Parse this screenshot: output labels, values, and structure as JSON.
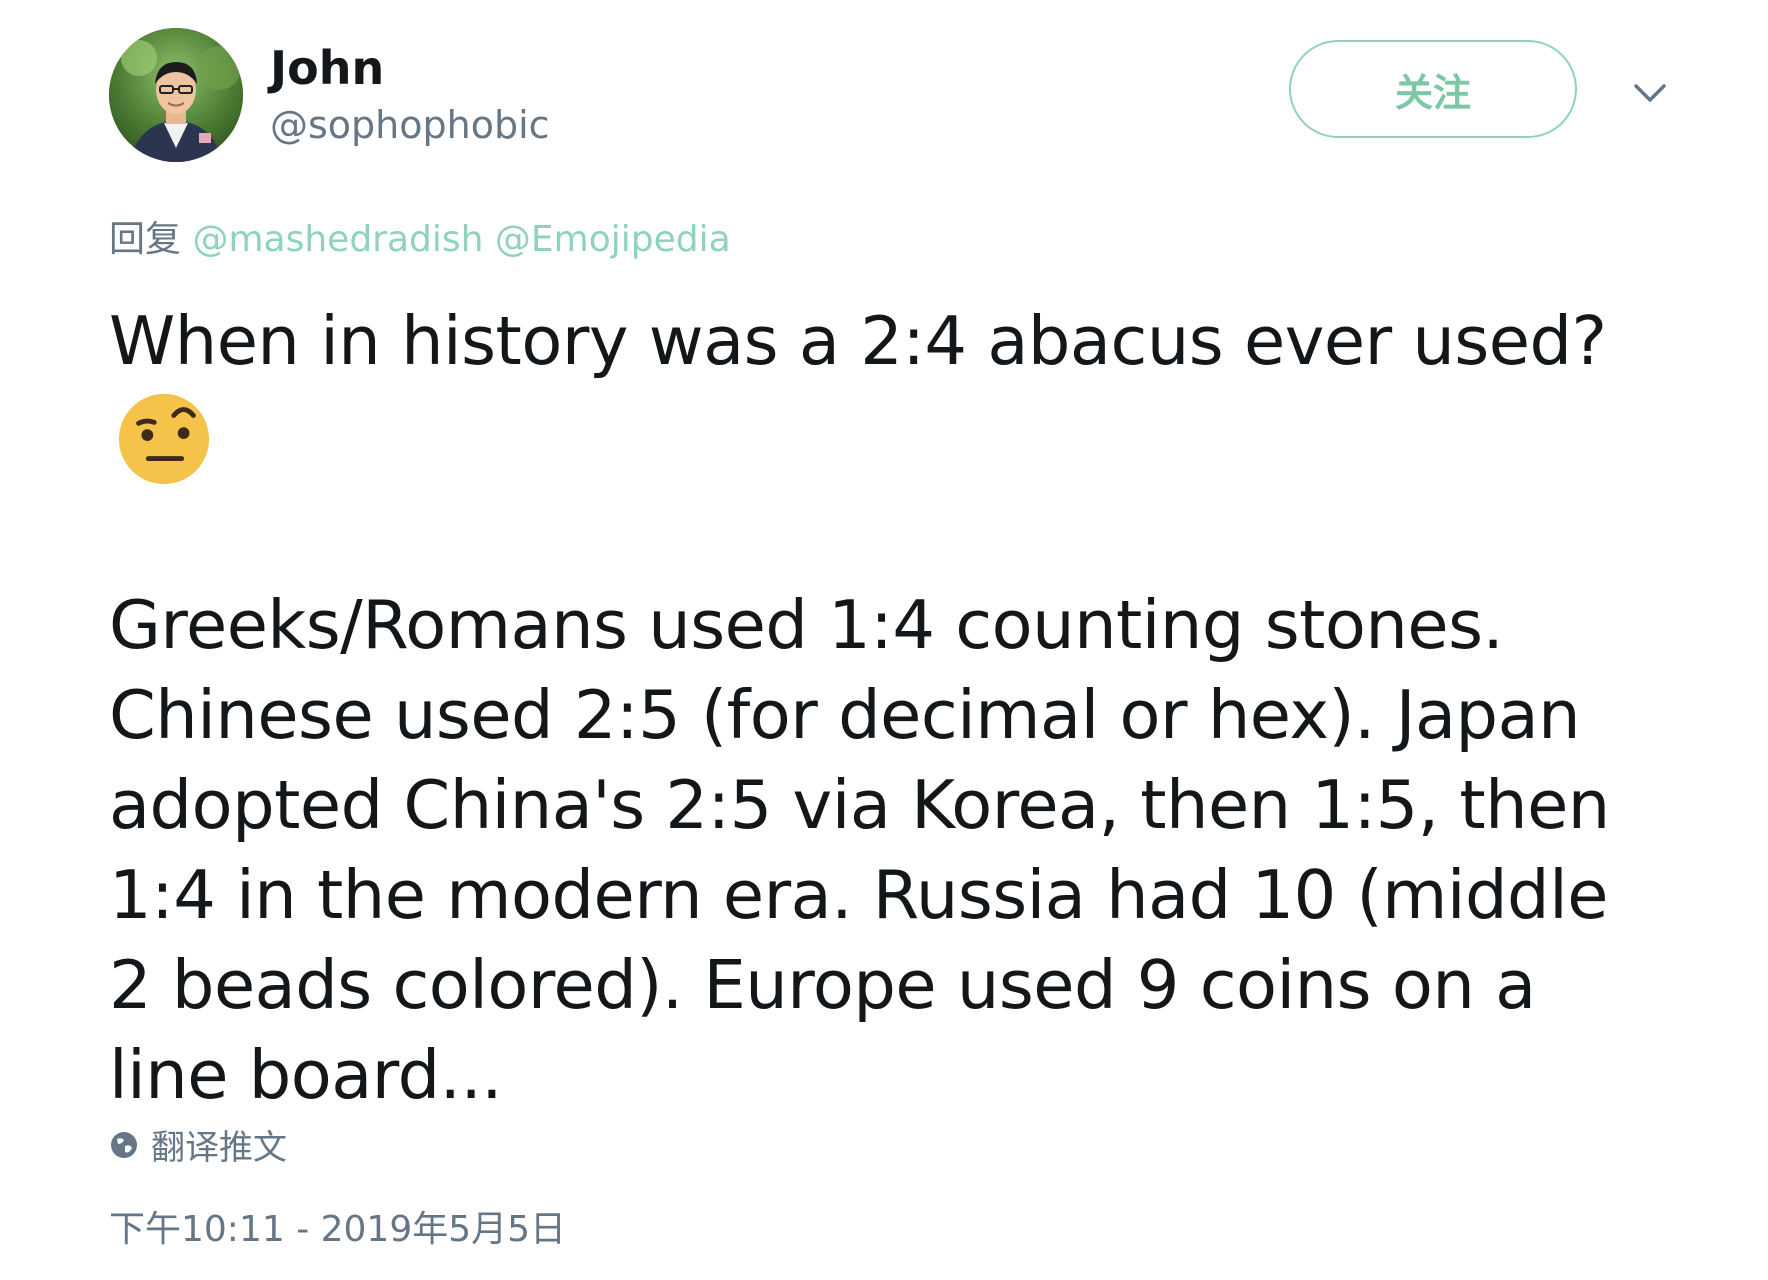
{
  "user": {
    "display_name": "John",
    "handle": "@sophophobic"
  },
  "follow_button": {
    "label": "关注"
  },
  "reply": {
    "prefix": "回复",
    "mentions": [
      "@mashedradish",
      "@Emojipedia"
    ]
  },
  "tweet": {
    "line1": "When in history was a 2:4 abacus ever used?",
    "emoji": "face-with-raised-eyebrow",
    "paragraph2": "Greeks/Romans used 1:4 counting stones. Chinese used 2:5 (for decimal or hex). Japan adopted China's 2:5 via Korea, then 1:5, then 1:4 in the modern era. Russia had 10 (middle 2 beads colored). Europe used 9 coins on a line board..."
  },
  "translate": {
    "icon": "globe-icon",
    "label": "翻译推文"
  },
  "timestamp": "下午10:11 - 2019年5月5日",
  "colors": {
    "accent": "#8fd3b8",
    "secondary_text": "#657786",
    "primary_text": "#14171a"
  }
}
